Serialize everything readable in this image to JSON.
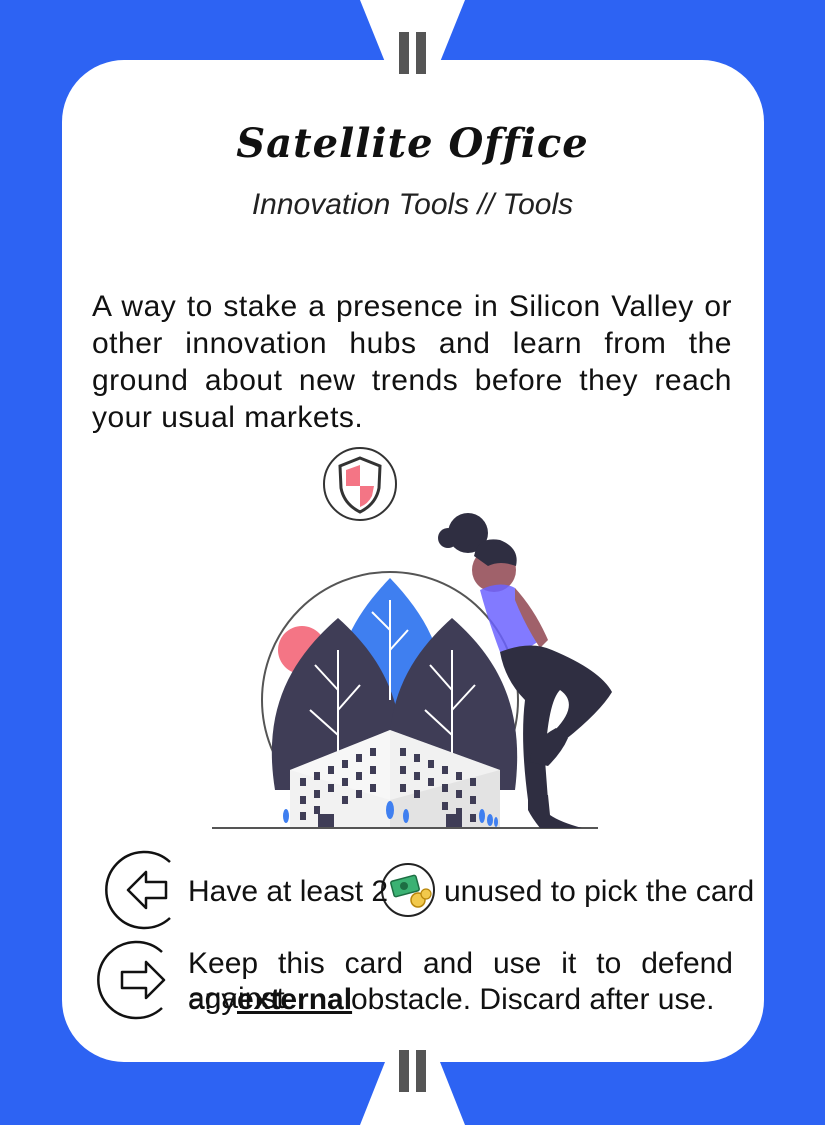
{
  "card": {
    "title": "Satellite Office",
    "subtitle": "Innovation Tools // Tools",
    "description": "A way to stake a presence in Silicon Valley or other innovation hubs and learn from the ground about new trends before they reach your usual markets.",
    "pick_rule": {
      "before": "Have at least 2",
      "icon": "money-icon",
      "after": "unused to pick the card"
    },
    "use_rule": {
      "before": "Keep this card and use it to defend against any",
      "emphasis": "external",
      "after": "obstacle. Discard after use."
    },
    "category_icon": "shield-icon",
    "colors": {
      "background": "#2d63f3",
      "card": "#ffffff",
      "accent_blue": "#3f7ff0",
      "accent_pink": "#f47585",
      "dark": "#3f3d56"
    }
  }
}
